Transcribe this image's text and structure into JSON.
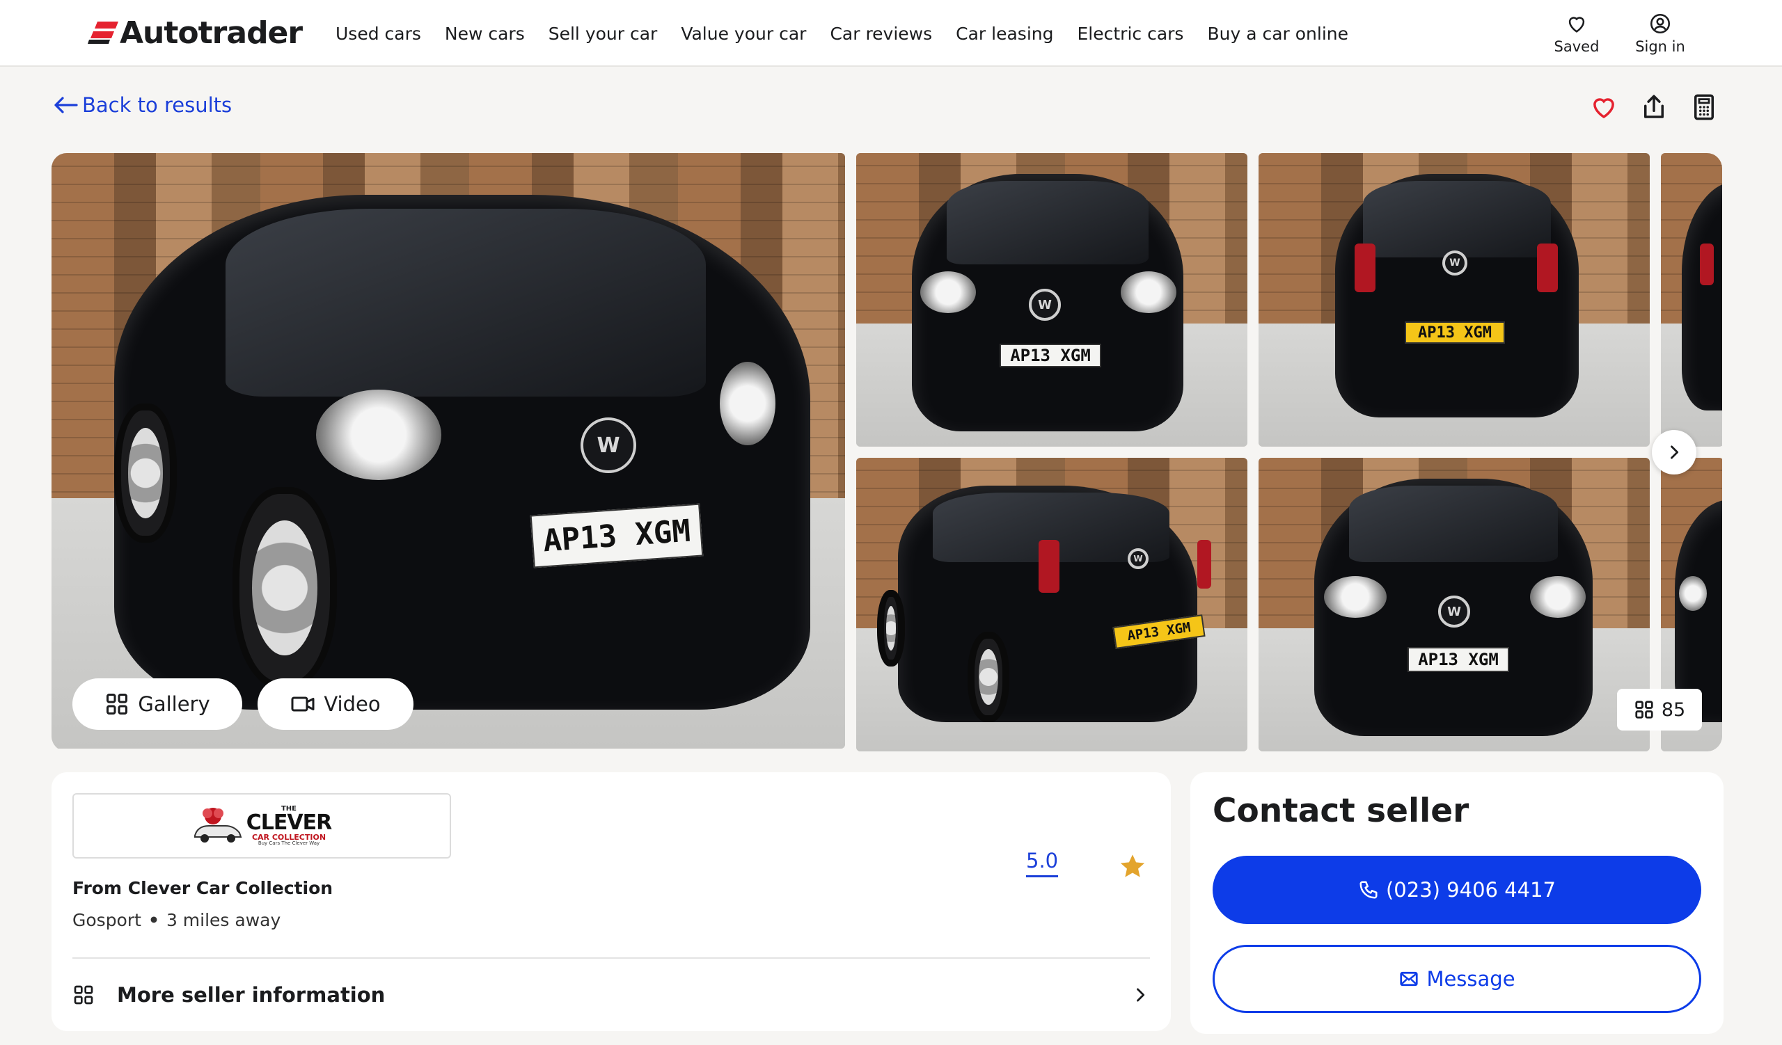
{
  "brand": {
    "name": "Autotrader",
    "accent": "#e5222f",
    "link_color": "#1b3fd9",
    "primary_button": "#0d3ce8"
  },
  "nav": {
    "items": [
      {
        "label": "Used cars"
      },
      {
        "label": "New cars"
      },
      {
        "label": "Sell your car"
      },
      {
        "label": "Value your car"
      },
      {
        "label": "Car reviews"
      },
      {
        "label": "Car leasing"
      },
      {
        "label": "Electric cars"
      },
      {
        "label": "Buy a car online"
      }
    ],
    "saved_label": "Saved",
    "signin_label": "Sign in"
  },
  "back": {
    "label": "Back to results"
  },
  "icons": {
    "favourite": "heart-icon",
    "share": "share-icon",
    "calculator": "calculator-icon"
  },
  "gallery": {
    "gallery_label": "Gallery",
    "video_label": "Video",
    "photo_count": "85",
    "plate": "AP13 XGM"
  },
  "seller": {
    "logo": {
      "line1": "THE",
      "line2": "CLEVER",
      "line3": "CAR COLLECTION",
      "line4": "Buy Cars The Clever Way"
    },
    "name": "From Clever Car Collection",
    "location": "Gosport",
    "distance": "3 miles away",
    "rating": "5.0",
    "more_info_label": "More seller information"
  },
  "contact": {
    "title": "Contact seller",
    "phone_label": "(023) 9406 4417",
    "message_label": "Message"
  }
}
